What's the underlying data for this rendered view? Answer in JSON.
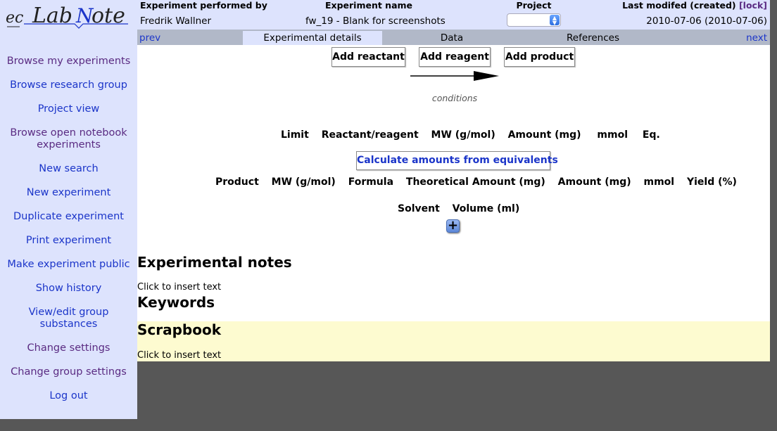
{
  "logo": {
    "text": "ecLabNote"
  },
  "sidebar": {
    "items": [
      {
        "label": "Browse my experiments",
        "visited": true
      },
      {
        "label": "Browse research group",
        "visited": false
      },
      {
        "label": "Project view",
        "visited": false
      },
      {
        "label": "Browse open notebook experiments",
        "visited": true
      },
      {
        "label": "New search",
        "visited": false
      },
      {
        "label": "New experiment",
        "visited": false
      },
      {
        "label": "Duplicate experiment",
        "visited": false
      },
      {
        "label": "Print experiment",
        "visited": false
      },
      {
        "label": "Make experiment public",
        "visited": false
      },
      {
        "label": "Show history",
        "visited": false
      },
      {
        "label": "View/edit group substances",
        "visited": false
      },
      {
        "label": "Change settings",
        "visited": true
      },
      {
        "label": "Change group settings",
        "visited": true
      },
      {
        "label": "Log out",
        "visited": false
      }
    ]
  },
  "header": {
    "performed_by_label": "Experiment performed by",
    "performed_by": "Fredrik Wallner",
    "name_label": "Experiment name",
    "name": "fw_19 - Blank for screenshots",
    "project_label": "Project",
    "project_value": "",
    "modified_label": "Last modifed (created)",
    "lock_label": "[lock]",
    "modified": "2010-07-06 (2010-07-06)"
  },
  "tabs": {
    "prev": "prev",
    "details": "Experimental details",
    "data": "Data",
    "references": "References",
    "next": "next"
  },
  "reaction": {
    "add_reactant": "Add reactant",
    "add_reagent": "Add reagent",
    "add_product": "Add product",
    "conditions": "conditions",
    "reactant_columns": [
      "Limit",
      "Reactant/reagent",
      "MW (g/mol)",
      "Amount (mg)",
      "mmol",
      "Eq."
    ],
    "calculate_button": "Calculate amounts from equivalents",
    "product_columns": [
      "Product",
      "MW (g/mol)",
      "Formula",
      "Theoretical Amount (mg)",
      "Amount (mg)",
      "mmol",
      "Yield (%)"
    ],
    "solvent_columns": [
      "Solvent",
      "Volume (ml)"
    ],
    "add_solvent": "+"
  },
  "notes": {
    "title": "Experimental notes",
    "placeholder": "Click to insert text"
  },
  "keywords": {
    "title": "Keywords"
  },
  "scrapbook": {
    "title": "Scrapbook",
    "placeholder": "Click to insert text"
  },
  "colors": {
    "sidebar_bg": "#dde3fd",
    "link": "#1b35c9",
    "visited_link": "#5a2b82",
    "scrapbook_bg": "#fdfbd0",
    "tabbar_bg": "#b1b8c8"
  }
}
